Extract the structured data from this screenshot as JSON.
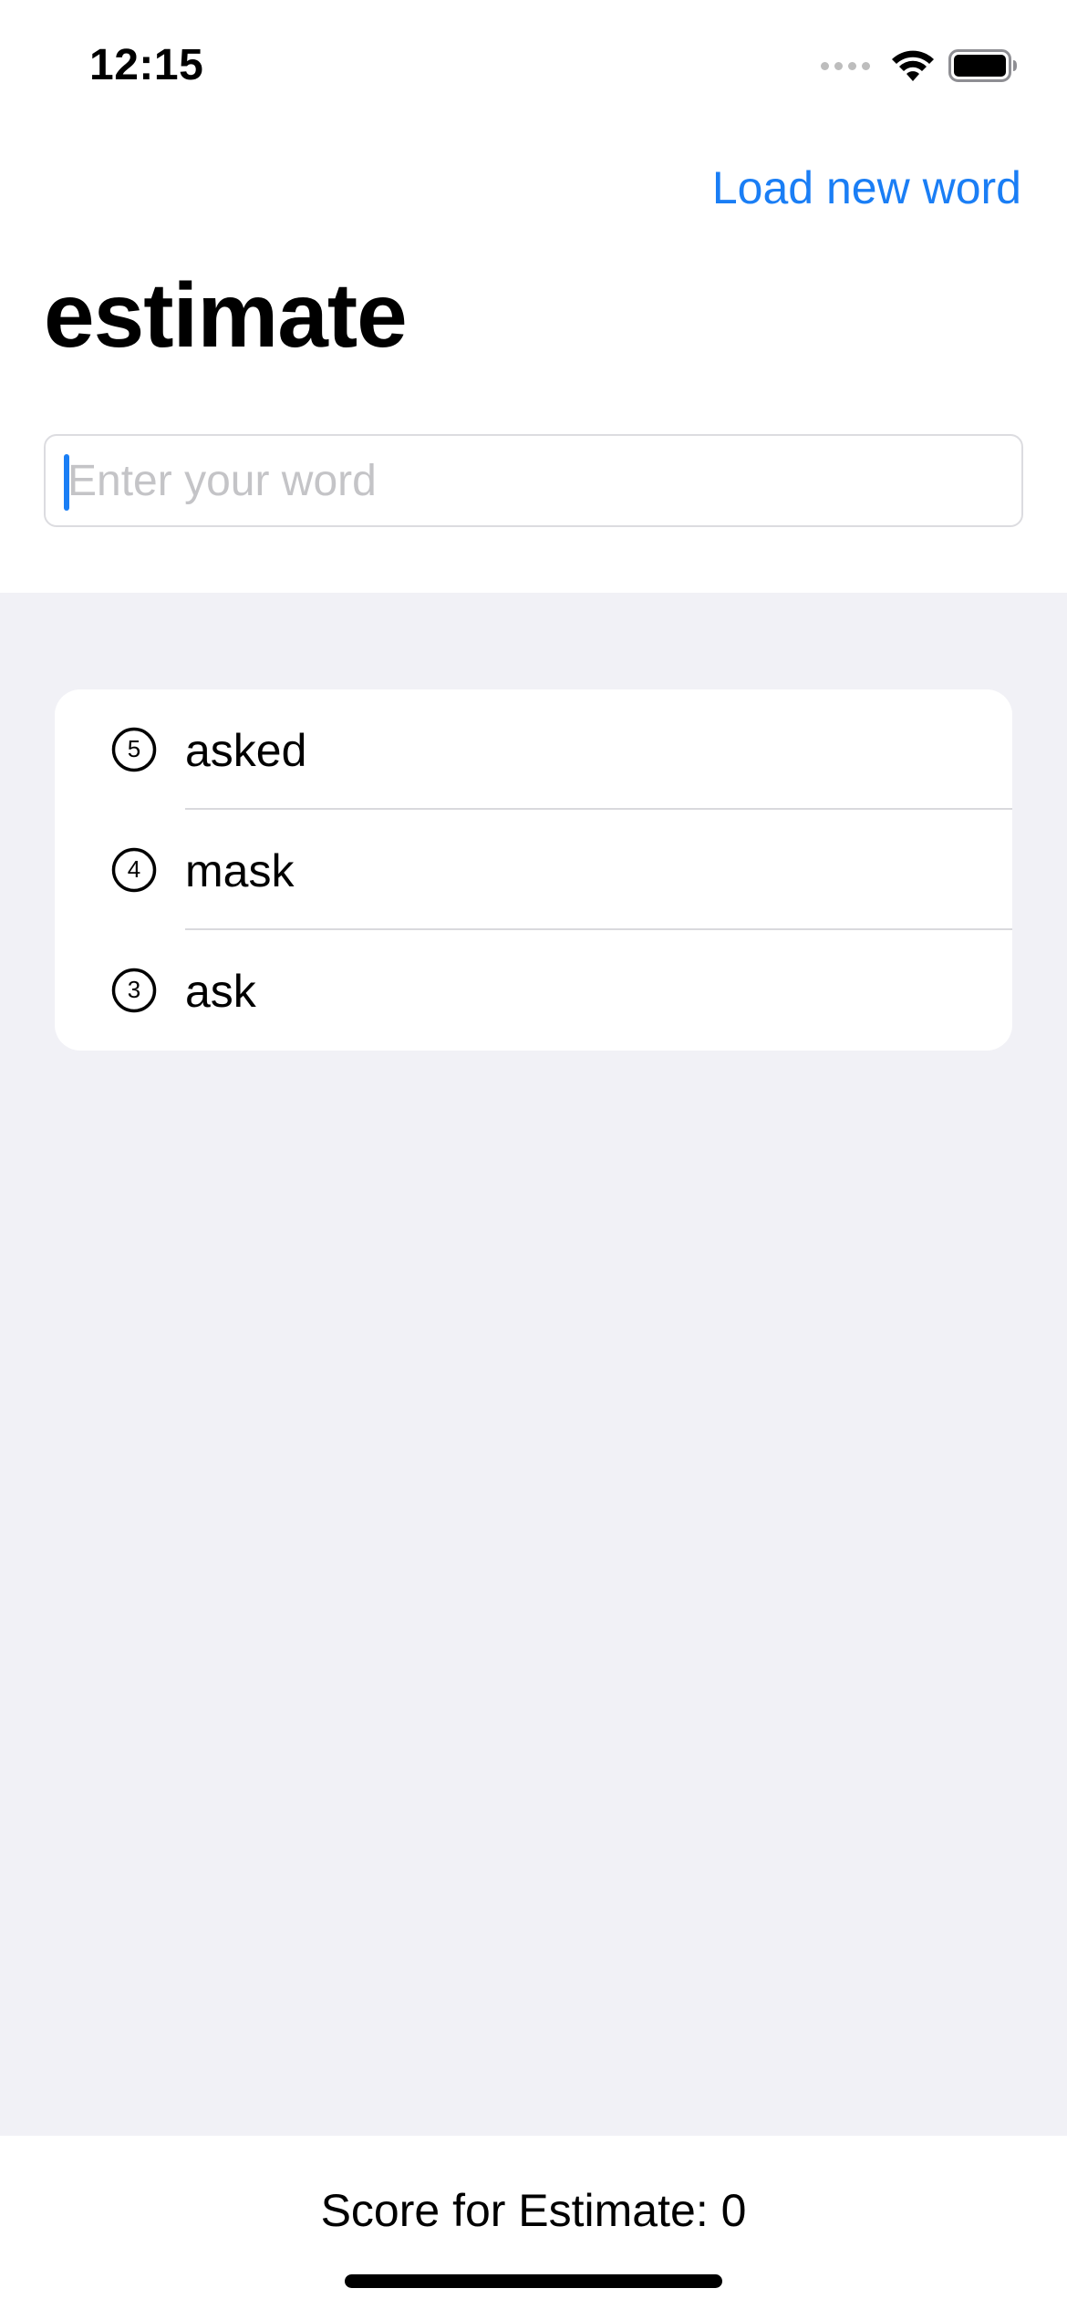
{
  "status_bar": {
    "time": "12:15",
    "signal_icon": "cellular-signal-icon",
    "wifi_icon": "wifi-icon",
    "battery_icon": "battery-full-icon"
  },
  "header": {
    "load_button_label": "Load new word",
    "title": "estimate"
  },
  "input": {
    "placeholder": "Enter your word",
    "value": ""
  },
  "words": [
    {
      "score": "5",
      "word": "asked"
    },
    {
      "score": "4",
      "word": "mask"
    },
    {
      "score": "3",
      "word": "ask"
    }
  ],
  "footer": {
    "score_text": "Score for Estimate: 0"
  },
  "colors": {
    "accent": "#1a7ef5",
    "grouped_background": "#f1f1f6",
    "separator": "#d9d9dd"
  }
}
